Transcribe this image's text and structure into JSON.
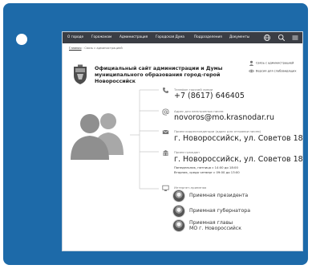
{
  "nav": {
    "items": [
      "О городе",
      "Горожанам",
      "Администрация",
      "Городская Дума",
      "Подразделения",
      "Документы"
    ]
  },
  "breadcrumb": {
    "home": "Главная",
    "separator": "›",
    "current": "Связь с администрацией"
  },
  "header": {
    "title_line1": "Официальный сайт администрации и Думы",
    "title_line2": "муниципального образования город-герой Новороссийск",
    "link_contact": "Связь с администрацией",
    "link_accessible": "Версия для слабовидящих"
  },
  "contacts": {
    "phone": {
      "label": "Телефон горячей линии",
      "value": "+7 (8617) 646405"
    },
    "email": {
      "label": "Адрес для электронных писем",
      "value": "novoros@mo.krasnodar.ru"
    },
    "post": {
      "label": "Прием корреспонденции (адрес для отправки писем)",
      "value": "г. Новороссийск, ул. Советов 18"
    },
    "reception": {
      "label": "Прием граждан",
      "value": "г. Новороссийск, ул. Советов 18",
      "hours_line1": "Понедельник, пятница с 14:00 до 18:00",
      "hours_line2": "Вторник, среда четверг с 09:00 до 13:00"
    },
    "internet": {
      "label": "Интернет-приемная",
      "items": [
        {
          "line1": "Приемная президента",
          "line2": ""
        },
        {
          "line1": "Приемная губернатора",
          "line2": ""
        },
        {
          "line1": "Приемная главы",
          "line2": "МО г. Новороссийск"
        }
      ]
    }
  },
  "colors": {
    "frame": "#1d6aa9",
    "navbar": "#3a3d44",
    "silhouette": "#8f8f8f",
    "connector": "#c8c8c8"
  }
}
